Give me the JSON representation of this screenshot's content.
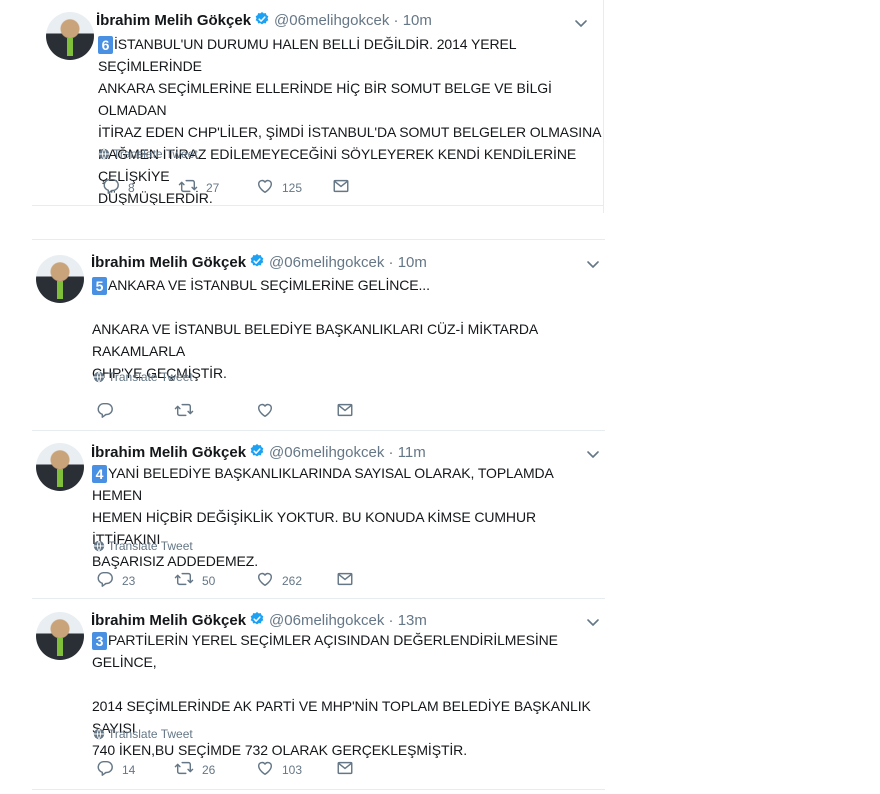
{
  "colors": {
    "accent": "#4a90e2",
    "muted": "#657786",
    "verified": "#1da1f2"
  },
  "icons": [
    "globe-icon",
    "reply-icon",
    "retweet-icon",
    "like-icon",
    "dm-icon",
    "chevron-down-icon",
    "verified-icon"
  ],
  "tweets": [
    {
      "name": "İbrahim Melih Gökçek",
      "handle": "@06melihgokcek",
      "sep": "·",
      "time": "10m",
      "badge": "6",
      "line1": "İSTANBUL'UN DURUMU HALEN BELLİ DEĞİLDİR. 2014 YEREL SEÇİMLERİNDE",
      "line2": "ANKARA SEÇİMLERİNE ELLERİNDE HİÇ BİR SOMUT BELGE VE BİLGİ OLMADAN",
      "line3": "İTİRAZ EDEN CHP'LİLER, ŞİMDİ İSTANBUL'DA SOMUT BELGELER OLMASINA",
      "line4": "RAĞMEN İTİRAZ EDİLEMEYECEĞİNİ SÖYLEYEREK KENDİ KENDİLERİNE ÇELİŞKİYE",
      "line5": "DÜŞMÜŞLERDİR.",
      "translate": "Translate Tweet",
      "replies": "8",
      "retweets": "27",
      "likes": "125"
    },
    {
      "name": "İbrahim Melih Gökçek",
      "handle": "@06melihgokcek",
      "sep": "·",
      "time": "10m",
      "badge": "5",
      "line1": "ANKARA VE İSTANBUL SEÇİMLERİNE GELİNCE...",
      "line2": "ANKARA VE İSTANBUL BELEDİYE BAŞKANLIKLARI CÜZ-İ MİKTARDA RAKAMLARLA",
      "line3": "CHP'YE GEÇMİŞTİR.",
      "translate": "Translate Tweet",
      "replies": "",
      "retweets": "",
      "likes": ""
    },
    {
      "name": "İbrahim Melih Gökçek",
      "handle": "@06melihgokcek",
      "sep": "·",
      "time": "11m",
      "badge": "4",
      "line1": "YANİ BELEDİYE BAŞKANLIKLARINDA SAYISAL OLARAK, TOPLAMDA HEMEN",
      "line2": "HEMEN HİÇBİR DEĞİŞİKLİK YOKTUR. BU KONUDA KİMSE CUMHUR İTTİFAKINI",
      "line3": "BAŞARISIZ ADDEDEMEZ.",
      "translate": "Translate Tweet",
      "replies": "23",
      "retweets": "50",
      "likes": "262"
    },
    {
      "name": "İbrahim Melih Gökçek",
      "handle": "@06melihgokcek",
      "sep": "·",
      "time": "13m",
      "badge": "3",
      "line1": "PARTİLERİN YEREL SEÇİMLER AÇISINDAN DEĞERLENDİRİLMESİNE GELİNCE,",
      "line2": "2014 SEÇİMLERİNDE AK PARTİ VE MHP'NİN TOPLAM BELEDİYE BAŞKANLIK SAYISI",
      "line3": "740 İKEN,BU SEÇİMDE 732 OLARAK GERÇEKLEŞMİŞTİR.",
      "translate": "Translate Tweet",
      "replies": "14",
      "retweets": "26",
      "likes": "103"
    }
  ]
}
